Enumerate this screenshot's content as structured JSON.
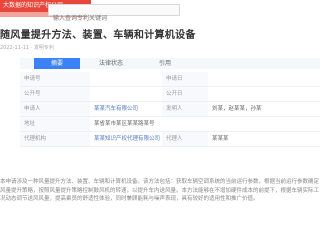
{
  "brand": {
    "line1": "大数据的知识产权公司"
  },
  "search": {
    "placeholder": "输入查询专利关键词"
  },
  "patent": {
    "title": "随风量提升方法、装置、车辆和计算机设备",
    "date_line": "2022-11-11 · 发明专利"
  },
  "tabs": [
    {
      "label": "摘要",
      "active": true
    },
    {
      "label": "法律状态",
      "active": false
    },
    {
      "label": "引用",
      "active": false
    }
  ],
  "rows": [
    {
      "label": "申请号",
      "value": "",
      "label2": "申请日",
      "value2": ""
    },
    {
      "label": "公开号",
      "value": "",
      "label2": "公开日",
      "value2": ""
    },
    {
      "label": "申请人",
      "value": "某某汽车有限公司",
      "label2": "发明人",
      "value2": "刘某，赵某某，孙某"
    },
    {
      "label": "地址",
      "value": "某省某市某区某某路某号",
      "label2": "",
      "value2": ""
    },
    {
      "label": "代理机构",
      "value": "某某知识产权代理有限公司",
      "label2": "代理人",
      "value2": "某某某"
    }
  ],
  "abstract": {
    "text": "本申请涉及一种风量提升方法、装置、车辆和计算机设备。该方法包括：获取车辆空调系统的当前运行参数，根据当前运行参数确定风量提升策略，按照风量提升策略控制鼓风机的转速，以提升车内送风量。本方法能够在不增加硬件成本的前提下，根据车辆实际工况动态调节送风风量，提高乘员的舒适性体验，同时兼顾能耗与噪声表现，具有较好的适用性和推广价值。"
  }
}
